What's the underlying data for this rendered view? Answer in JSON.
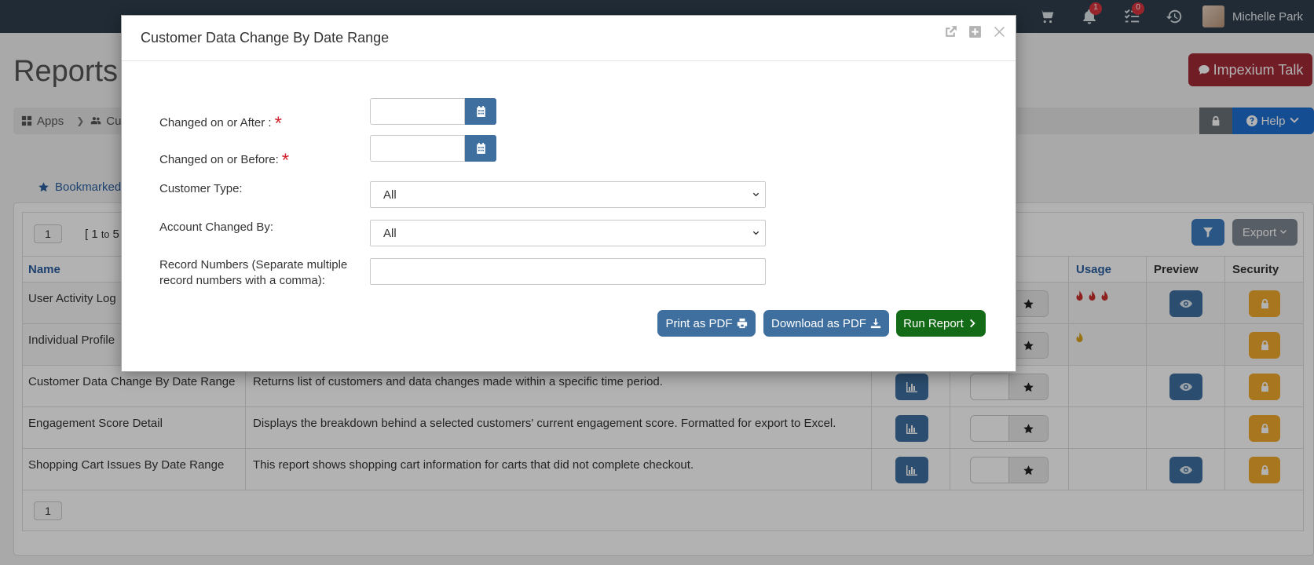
{
  "topbar": {
    "cart_badge": "",
    "notifications_badge": "1",
    "tasks_badge": "0",
    "user_name": "Michelle Park"
  },
  "page": {
    "title": "Reports",
    "talk_button": "Impexium Talk",
    "breadcrumb": {
      "apps": "Apps",
      "customers": "Cust"
    },
    "help_button": "Help",
    "tab": "Bookmarked"
  },
  "report_grid": {
    "pager_top": "1",
    "pager_bottom": "1",
    "range_prefix": "[ 1",
    "range_to": "to",
    "range_suffix": "5",
    "export_button": "Export",
    "headers": {
      "name": "Name",
      "usage": "Usage",
      "preview": "Preview",
      "security": "Security"
    },
    "rows": [
      {
        "name": "User Activity Log",
        "description": "",
        "usage": 3,
        "usage_color": "#c9302c",
        "preview": true
      },
      {
        "name": "Individual Profile",
        "description": "",
        "usage": 1,
        "usage_color": "#d9a21b",
        "preview": false
      },
      {
        "name": "Customer Data Change By Date Range",
        "description": "Returns list of customers and data changes made within a specific time period.",
        "usage": 0,
        "preview": true
      },
      {
        "name": "Engagement Score Detail",
        "description": "Displays the breakdown behind a selected customers' current engagement score. Formatted for export to Excel.",
        "usage": 0,
        "preview": false
      },
      {
        "name": "Shopping Cart Issues By Date Range",
        "description": "This report shows shopping cart information for carts that did not complete checkout.",
        "usage": 0,
        "preview": true
      }
    ]
  },
  "modal": {
    "title": "Customer Data Change By Date Range",
    "fields": {
      "changed_after_label": "Changed on or After :",
      "changed_before_label": "Changed on or Before:",
      "required_mark": "*",
      "customer_type_label": "Customer Type:",
      "customer_type_value": "All",
      "account_changed_by_label": "Account Changed By:",
      "account_changed_by_value": "All",
      "record_numbers_label_line1": "Record Numbers (Separate multiple",
      "record_numbers_label_line2": "record numbers with a comma):",
      "changed_after_value": "",
      "changed_before_value": "",
      "record_numbers_value": ""
    },
    "buttons": {
      "print_pdf": "Print as PDF",
      "download_pdf": "Download as PDF",
      "run_report": "Run Report"
    }
  },
  "colors": {
    "topbar": "#2f3e4c",
    "primary_button": "#3e6f9f",
    "run_button": "#146b17",
    "security_button": "#f0a92b",
    "talk_button": "#a32a36",
    "required": "#d0252e"
  }
}
